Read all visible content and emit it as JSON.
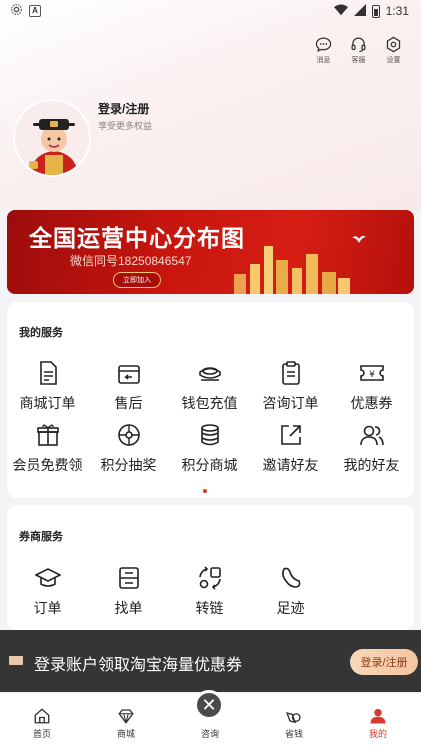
{
  "status_bar": {
    "time": "1:31"
  },
  "top_actions": [
    {
      "icon": "message-icon",
      "label": "消息"
    },
    {
      "icon": "headset-icon",
      "label": "客服"
    },
    {
      "icon": "settings-icon",
      "label": "设置"
    }
  ],
  "profile": {
    "title": "登录/注册",
    "subtitle": "享受更多权益"
  },
  "banner": {
    "title": "全国运营中心分布图",
    "subtitle": "微信同号18250846547",
    "button": "立即加入"
  },
  "my_services": {
    "title": "我的服务",
    "items": [
      {
        "icon": "document-icon",
        "label": "商城订单"
      },
      {
        "icon": "return-icon",
        "label": "售后"
      },
      {
        "icon": "wallet-icon",
        "label": "钱包充值"
      },
      {
        "icon": "clipboard-icon",
        "label": "咨询订单"
      },
      {
        "icon": "coupon-icon",
        "label": "优惠券"
      },
      {
        "icon": "gift-icon",
        "label": "会员免费领"
      },
      {
        "icon": "lottery-wheel-icon",
        "label": "积分抽奖"
      },
      {
        "icon": "coins-icon",
        "label": "积分商城"
      },
      {
        "icon": "share-icon",
        "label": "邀请好友"
      },
      {
        "icon": "friends-icon",
        "label": "我的好友"
      }
    ]
  },
  "broker_services": {
    "title": "券商服务",
    "items": [
      {
        "icon": "graduation-cap-icon",
        "label": "订单"
      },
      {
        "icon": "cabinet-icon",
        "label": "找单"
      },
      {
        "icon": "convert-link-icon",
        "label": "转链"
      },
      {
        "icon": "footprint-icon",
        "label": "足迹"
      }
    ]
  },
  "login_bar": {
    "text": "登录账户领取淘宝海量优惠券",
    "button": "登录/注册"
  },
  "tabbar": {
    "items": [
      {
        "icon": "home-icon",
        "label": "首页"
      },
      {
        "icon": "mall-icon",
        "label": "商城"
      },
      {
        "icon": "consult-icon",
        "label": "咨询"
      },
      {
        "icon": "save-money-icon",
        "label": "省钱"
      },
      {
        "icon": "profile-icon",
        "label": "我的"
      }
    ]
  },
  "colors": {
    "accent": "#d9382f",
    "banner": "#c8160f",
    "login_bar": "#262626"
  }
}
